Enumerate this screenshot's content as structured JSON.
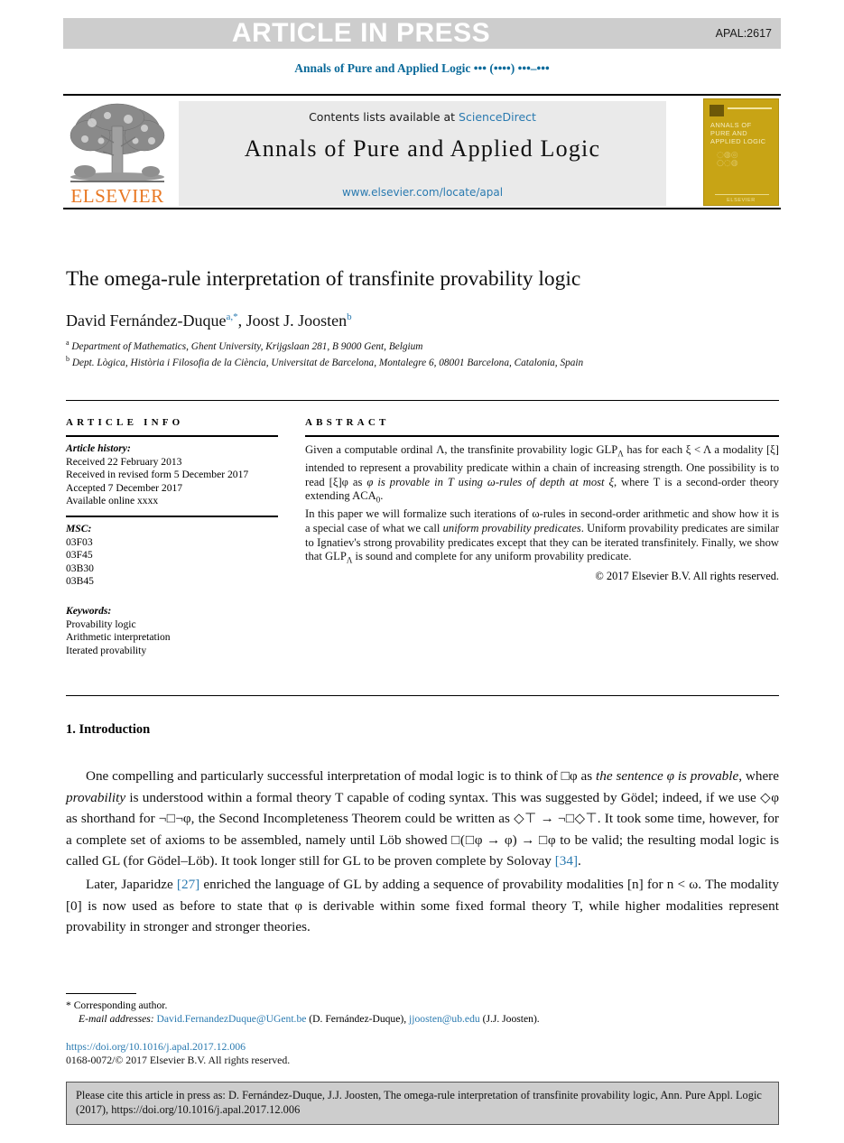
{
  "banner": {
    "title": "ARTICLE IN PRESS",
    "code": "APAL:2617",
    "bg_color": "#cdcdcd",
    "text_color": "#ffffff"
  },
  "running_head": "Annals of Pure and Applied Logic ••• (••••) •••–•••",
  "masthead": {
    "publisher_name": "ELSEVIER",
    "publisher_color": "#e87722",
    "contents_line": "Contents lists available at ",
    "contents_link": "ScienceDirect",
    "journal_title": "Annals of Pure and Applied Logic",
    "journal_url": "www.elsevier.com/locate/apal",
    "link_color": "#2a7ab0",
    "cover": {
      "title": "ANNALS OF PURE AND APPLIED LOGIC",
      "bg_color": "#c8a415",
      "footer": "ELSEVIER"
    }
  },
  "article": {
    "title": "The omega-rule interpretation of transfinite provability logic",
    "authors_part1": "David Fernández-Duque",
    "authors_sup1": "a,*",
    "authors_part2": ", Joost J. Joosten",
    "authors_sup2": "b",
    "affiliation_a_sup": "a",
    "affiliation_a": "Department of Mathematics, Ghent University, Krijgslaan 281, B 9000 Gent, Belgium",
    "affiliation_b_sup": "b",
    "affiliation_b": "Dept. Lògica, Història i Filosofia de la Ciència, Universitat de Barcelona, Montalegre 6, 08001 Barcelona, Catalonia, Spain"
  },
  "info": {
    "heading": "ARTICLE INFO",
    "history_label": "Article history:",
    "history": [
      "Received 22 February 2013",
      "Received in revised form 5 December 2017",
      "Accepted 7 December 2017",
      "Available online xxxx"
    ],
    "msc_label": "MSC:",
    "msc": [
      "03F03",
      "03F45",
      "03B30",
      "03B45"
    ],
    "keywords_label": "Keywords:",
    "keywords": [
      "Provability logic",
      "Arithmetic interpretation",
      "Iterated provability"
    ]
  },
  "abstract": {
    "heading": "ABSTRACT",
    "lines": [
      "Given a computable ordinal Λ, the transfinite provability logic GLP_Λ has for each ξ < Λ a modality [ξ] intended to represent a provability predicate within a chain of increasing strength. One possibility is to read [ξ]φ as φ is provable in T using ω-rules of depth at most ξ, where T is a second-order theory extending ACA₀.",
      "In this paper we will formalize such iterations of ω-rules in second-order arithmetic and show how it is a special case of what we call uniform provability predicates. Uniform provability predicates are similar to Ignatiev's strong provability predicates except that they can be iterated transfinitely. Finally, we show that GLP_Λ is sound and complete for any uniform provability predicate."
    ],
    "copyright": "© 2017 Elsevier B.V. All rights reserved."
  },
  "section": {
    "number_title": "1. Introduction",
    "paragraph1": "One compelling and particularly successful interpretation of modal logic is to think of □φ as the sentence φ is provable, where provability is understood within a formal theory T capable of coding syntax. This was suggested by Gödel; indeed, if we use ◇φ as shorthand for ¬□¬φ, the Second Incompleteness Theorem could be written as ◇⊤ → ¬□◇⊤. It took some time, however, for a complete set of axioms to be assembled, namely until Löb showed □(□φ → φ) → □φ to be valid; the resulting modal logic is called GL (for Gödel–Löb). It took longer still for GL to be proven complete by Solovay [34].",
    "paragraph1_ref": "[34]",
    "paragraph2": "Later, Japaridze [27] enriched the language of GL by adding a sequence of provability modalities [n] for n < ω. The modality [0] is now used as before to state that φ is derivable within some fixed formal theory T, while higher modalities represent provability in stronger and stronger theories.",
    "paragraph2_ref": "[27]"
  },
  "footnotes": {
    "corresponding_marker": "*",
    "corresponding": "Corresponding author.",
    "email_label": "E-mail addresses:",
    "email1": "David.FernandezDuque@UGent.be",
    "email1_owner": "(D. Fernández-Duque),",
    "email2": "jjoosten@ub.edu",
    "email2_owner": "(J.J. Joosten).",
    "doi": "https://doi.org/10.1016/j.apal.2017.12.006",
    "issn_line": "0168-0072/© 2017 Elsevier B.V. All rights reserved."
  },
  "cite_box": {
    "text": "Please cite this article in press as: D. Fernández-Duque, J.J. Joosten, The omega-rule interpretation of transfinite provability logic, Ann. Pure Appl. Logic (2017), https://doi.org/10.1016/j.apal.2017.12.006",
    "bg_color": "#cdcdcd"
  }
}
